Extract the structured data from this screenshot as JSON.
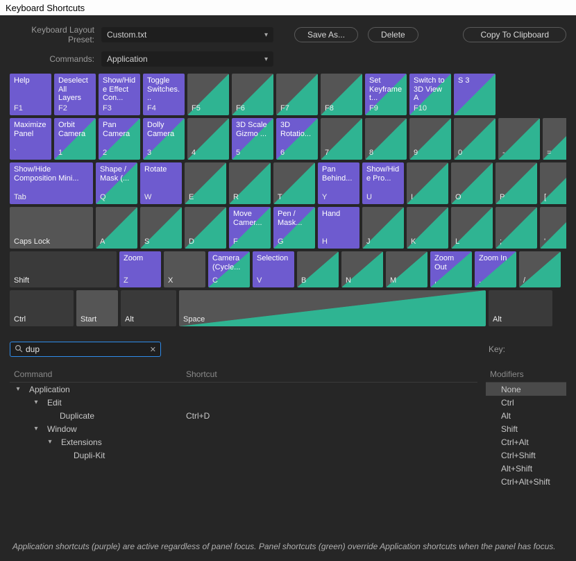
{
  "window": {
    "title": "Keyboard Shortcuts"
  },
  "preset": {
    "label": "Keyboard Layout Preset:",
    "value": "Custom.txt"
  },
  "commands_label": "Commands:",
  "commands_value": "Application",
  "buttons": {
    "save_as": "Save As...",
    "delete": "Delete",
    "copy_clipboard": "Copy To Clipboard"
  },
  "keyboard": {
    "r1": [
      {
        "desc": "Help",
        "k": "F1",
        "type": "purple"
      },
      {
        "desc": "Deselect All Layers",
        "k": "F2",
        "type": "purple"
      },
      {
        "desc": "Show/Hide Effect Con...",
        "k": "F3",
        "type": "purple"
      },
      {
        "desc": "Toggle Switches...",
        "k": "F4",
        "type": "purple"
      },
      {
        "desc": "",
        "k": "F5",
        "type": "splitgray"
      },
      {
        "desc": "",
        "k": "F6",
        "type": "splitgray"
      },
      {
        "desc": "",
        "k": "F7",
        "type": "splitgray"
      },
      {
        "desc": "",
        "k": "F8",
        "type": "splitgray"
      },
      {
        "desc": "Set Keyframe t...",
        "k": "F9",
        "type": "split"
      },
      {
        "desc": "Switch to 3D View A",
        "k": "F10",
        "type": "split"
      },
      {
        "desc": "S\n3",
        "k": "",
        "type": "split"
      }
    ],
    "r2": [
      {
        "desc": "Maximize Panel",
        "k": "`",
        "type": "purple"
      },
      {
        "desc": "Orbit Camera",
        "k": "1",
        "type": "split"
      },
      {
        "desc": "Pan Camera",
        "k": "2",
        "type": "split"
      },
      {
        "desc": "Dolly Camera",
        "k": "3",
        "type": "split"
      },
      {
        "desc": "",
        "k": "4",
        "type": "splitgray"
      },
      {
        "desc": "3D Scale Gizmo ...",
        "k": "5",
        "type": "split"
      },
      {
        "desc": "3D Rotatio...",
        "k": "6",
        "type": "split"
      },
      {
        "desc": "",
        "k": "7",
        "type": "splitgray"
      },
      {
        "desc": "",
        "k": "8",
        "type": "splitgray"
      },
      {
        "desc": "",
        "k": "9",
        "type": "splitgray"
      },
      {
        "desc": "",
        "k": "0",
        "type": "splitgray"
      },
      {
        "desc": "",
        "k": "-",
        "type": "splitgray"
      },
      {
        "desc": "",
        "k": "=",
        "type": "splitgray"
      }
    ],
    "r3": [
      {
        "desc": "Show/Hide Composition Mini...",
        "k": "Tab",
        "type": "purple",
        "cls": "w-caps"
      },
      {
        "desc": "Shape / Mask (...",
        "k": "Q",
        "type": "split"
      },
      {
        "desc": "Rotate",
        "k": "W",
        "type": "purple"
      },
      {
        "desc": "",
        "k": "E",
        "type": "splitgray"
      },
      {
        "desc": "",
        "k": "R",
        "type": "splitgray"
      },
      {
        "desc": "",
        "k": "T",
        "type": "splitgray"
      },
      {
        "desc": "Pan Behind...",
        "k": "Y",
        "type": "purple"
      },
      {
        "desc": "Show/Hide Pro...",
        "k": "U",
        "type": "purple"
      },
      {
        "desc": "",
        "k": "I",
        "type": "splitgray"
      },
      {
        "desc": "",
        "k": "O",
        "type": "splitgray"
      },
      {
        "desc": "",
        "k": "P",
        "type": "splitgray"
      },
      {
        "desc": "",
        "k": "[",
        "type": "splitgray"
      }
    ],
    "r4": [
      {
        "desc": "",
        "k": "Caps Lock",
        "type": "gray",
        "cls": "w-caps"
      },
      {
        "desc": "",
        "k": "A",
        "type": "splitgray"
      },
      {
        "desc": "",
        "k": "S",
        "type": "splitgray"
      },
      {
        "desc": "",
        "k": "D",
        "type": "splitgray"
      },
      {
        "desc": "Move Camer...",
        "k": "F",
        "type": "split"
      },
      {
        "desc": "Pen / Mask...",
        "k": "G",
        "type": "split"
      },
      {
        "desc": "Hand",
        "k": "H",
        "type": "purple"
      },
      {
        "desc": "",
        "k": "J",
        "type": "splitgray"
      },
      {
        "desc": "",
        "k": "K",
        "type": "splitgray"
      },
      {
        "desc": "",
        "k": "L",
        "type": "splitgray"
      },
      {
        "desc": "",
        "k": ";",
        "type": "splitgray"
      },
      {
        "desc": "",
        "k": "'",
        "type": "splitgray"
      }
    ],
    "r5": [
      {
        "desc": "",
        "k": "Shift",
        "type": "dark",
        "cls": "w-shift"
      },
      {
        "desc": "Zoom",
        "k": "Z",
        "type": "purple"
      },
      {
        "desc": "",
        "k": "X",
        "type": "gray"
      },
      {
        "desc": "Camera (Cycle...",
        "k": "C",
        "type": "split"
      },
      {
        "desc": "Selection",
        "k": "V",
        "type": "purple"
      },
      {
        "desc": "",
        "k": "B",
        "type": "splitgray"
      },
      {
        "desc": "",
        "k": "N",
        "type": "splitgray"
      },
      {
        "desc": "",
        "k": "M",
        "type": "splitgray"
      },
      {
        "desc": "Zoom Out",
        "k": ",",
        "type": "split"
      },
      {
        "desc": "Zoom In",
        "k": ".",
        "type": "split"
      },
      {
        "desc": "",
        "k": "/",
        "type": "splitgray"
      }
    ],
    "r6": [
      {
        "desc": "",
        "k": "Ctrl",
        "type": "dark",
        "cls": "w-ctrl"
      },
      {
        "desc": "",
        "k": "Start",
        "type": "gray",
        "cls": "w-start"
      },
      {
        "desc": "",
        "k": "Alt",
        "type": "dark",
        "cls": "w-alt"
      },
      {
        "desc": "",
        "k": "Space",
        "type": "splitgray",
        "cls": "w-space"
      },
      {
        "desc": "",
        "k": "Alt",
        "type": "dark",
        "cls": "w-altR"
      }
    ]
  },
  "search": {
    "value": "dup"
  },
  "key_label": "Key:",
  "table": {
    "headers": {
      "command": "Command",
      "shortcut": "Shortcut"
    },
    "root": "Application",
    "r1": "Edit",
    "r2": "Duplicate",
    "r2_sc": "Ctrl+D",
    "r3": "Window",
    "r4": "Extensions",
    "r5": "Dupli-Kit"
  },
  "modifiers": {
    "header": "Modifiers",
    "items": [
      "None",
      "Ctrl",
      "Alt",
      "Shift",
      "Ctrl+Alt",
      "Ctrl+Shift",
      "Alt+Shift",
      "Ctrl+Alt+Shift"
    ]
  },
  "footer": "Application shortcuts (purple) are active regardless of panel focus. Panel shortcuts (green) override Application shortcuts when the panel has focus."
}
